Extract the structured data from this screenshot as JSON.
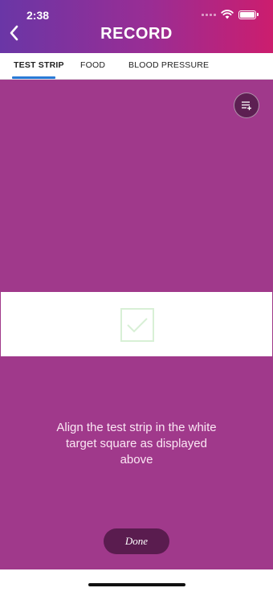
{
  "status_bar": {
    "time": "2:38"
  },
  "header": {
    "title": "RECORD",
    "back_icon": "chevron-left-icon"
  },
  "tabs": [
    {
      "label": "TEST STRIP",
      "active": true
    },
    {
      "label": "FOOD",
      "active": false
    },
    {
      "label": "BLOOD PRESSURE",
      "active": false
    }
  ],
  "camera": {
    "menu_icon": "list-add-icon",
    "target_icon": "checkmark-icon",
    "instruction": "Align the test strip in the white target square as displayed above"
  },
  "actions": {
    "done_label": "Done"
  },
  "colors": {
    "header_gradient_start": "#6a36a6",
    "header_gradient_end": "#cc1d6e",
    "camera_background": "#a0398b",
    "tab_indicator": "#2979d6",
    "done_button": "#5a1c4f"
  }
}
